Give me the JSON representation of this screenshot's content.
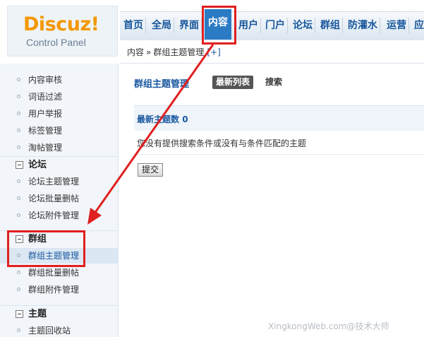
{
  "logo": {
    "brand": "Discuz!",
    "subtitle": "Control Panel"
  },
  "nav": {
    "items": [
      "首页",
      "全局",
      "界面",
      "内容",
      "用户",
      "门户",
      "论坛",
      "群组",
      "防灌水",
      "运营",
      "应"
    ],
    "active": "内容"
  },
  "breadcrumb": {
    "root": "内容",
    "separator": "»",
    "current": "群组主题管理",
    "add": "[+]"
  },
  "sidebar": {
    "items_top": [
      "内容审核",
      "词语过滤",
      "用户举报",
      "标签管理",
      "淘帖管理"
    ],
    "group_forum": {
      "label": "论坛",
      "items": [
        "论坛主题管理",
        "论坛批量删帖",
        "论坛附件管理"
      ]
    },
    "group_group": {
      "label": "群组",
      "items": [
        "群组主题管理",
        "群组批量删帖",
        "群组附件管理"
      ],
      "selected": "群组主题管理"
    },
    "group_thread": {
      "label": "主题",
      "items": [
        "主题回收站"
      ]
    }
  },
  "main": {
    "title": "群组主题管理",
    "tab_latest": "最新列表",
    "tab_search": "搜索",
    "count_label": "最新主题数",
    "count_value": "0",
    "empty_message": "您没有提供搜索条件或没有与条件匹配的主题",
    "submit_label": "提交"
  },
  "watermark": "XingkongWeb.com@技术大师",
  "colors": {
    "accent": "#1a58a0",
    "brand": "#f39800",
    "annotation": "#e02020",
    "nav_active": "#2b7bc4"
  }
}
